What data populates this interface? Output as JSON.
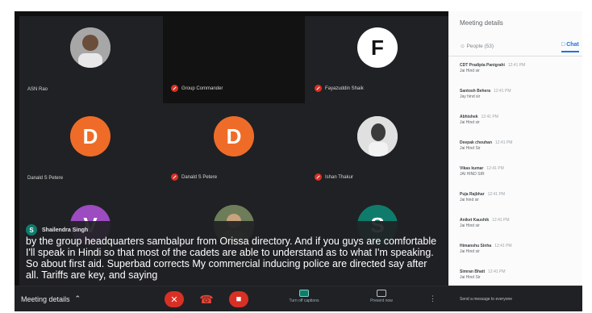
{
  "tiles": [
    {
      "id": "t1",
      "name": "ASN Rao",
      "initial": "",
      "avatar": "photo",
      "color": "#6b6b6b",
      "muted": false
    },
    {
      "id": "t2",
      "name": "Group Commander",
      "initial": "",
      "avatar": "none",
      "color": "#121212",
      "muted": true
    },
    {
      "id": "t3",
      "name": "Fayazuddin Shaik",
      "initial": "F",
      "avatar": "letter-white",
      "color": "#ffffff",
      "muted": true
    },
    {
      "id": "t4",
      "name": "Danald S Petere",
      "initial": "D",
      "avatar": "letter",
      "color": "#ef6c28",
      "muted": false
    },
    {
      "id": "t5",
      "name": "Danald S Petere",
      "initial": "D",
      "avatar": "letter",
      "color": "#ef6c28",
      "muted": true
    },
    {
      "id": "t6",
      "name": "Ishan Thakur",
      "initial": "",
      "avatar": "photo",
      "color": "#cfcfcf",
      "muted": true
    },
    {
      "id": "t7",
      "name": "Shailendra Singh",
      "initial": "V",
      "avatar": "letter",
      "color": "#9c4bc0",
      "muted": false
    },
    {
      "id": "t8",
      "name": "",
      "initial": "",
      "avatar": "photo",
      "color": "#5b6b4a",
      "muted": false
    },
    {
      "id": "t9",
      "name": "",
      "initial": "S",
      "avatar": "letter",
      "color": "#0f7c6b",
      "muted": false
    }
  ],
  "caption": {
    "speaker_initial": "S",
    "speaker_name": "Shailendra Singh",
    "text": "by the group headquarters sambalpur from Orissa directory. And if you guys are comfortable I'll speak in Hindi so that most of the cadets are able to understand as to what I'm speaking. So about first aid. Superbad corrects My commercial inducing police are directed say after all. Tariffs are key, and saying"
  },
  "bottom_bar": {
    "meeting_details": "Meeting details",
    "captions_label": "Turn off captions",
    "present_label": "Present now"
  },
  "panel": {
    "title": "Meeting details",
    "people_tab": "People (53)",
    "chat_tab": "Chat",
    "messages": [
      {
        "who": "CDT Pradipta Panigrahi",
        "time": "12:41 PM",
        "text": "Jai Hind sir"
      },
      {
        "who": "Santosh Behera",
        "time": "12:41 PM",
        "text": "Jay hind sir"
      },
      {
        "who": "Abhishek",
        "time": "12:41 PM",
        "text": "Jai Hind sir"
      },
      {
        "who": "Deepak chouhan",
        "time": "12:41 PM",
        "text": "Jai Hind Sir"
      },
      {
        "who": "Vikas kumar",
        "time": "12:41 PM",
        "text": "JAI HIND SIR"
      },
      {
        "who": "Puja Rajbhar",
        "time": "12:41 PM",
        "text": "Jai hind sir"
      },
      {
        "who": "Aniket Kaushik",
        "time": "12:41 PM",
        "text": "Jai Hind sir"
      },
      {
        "who": "Himanshu Sinha",
        "time": "12:41 PM",
        "text": "Jai Hind sir"
      },
      {
        "who": "Simran Bhatt",
        "time": "12:41 PM",
        "text": "Jai Hind Sir"
      }
    ],
    "input_placeholder": "Send a message to everyone"
  }
}
